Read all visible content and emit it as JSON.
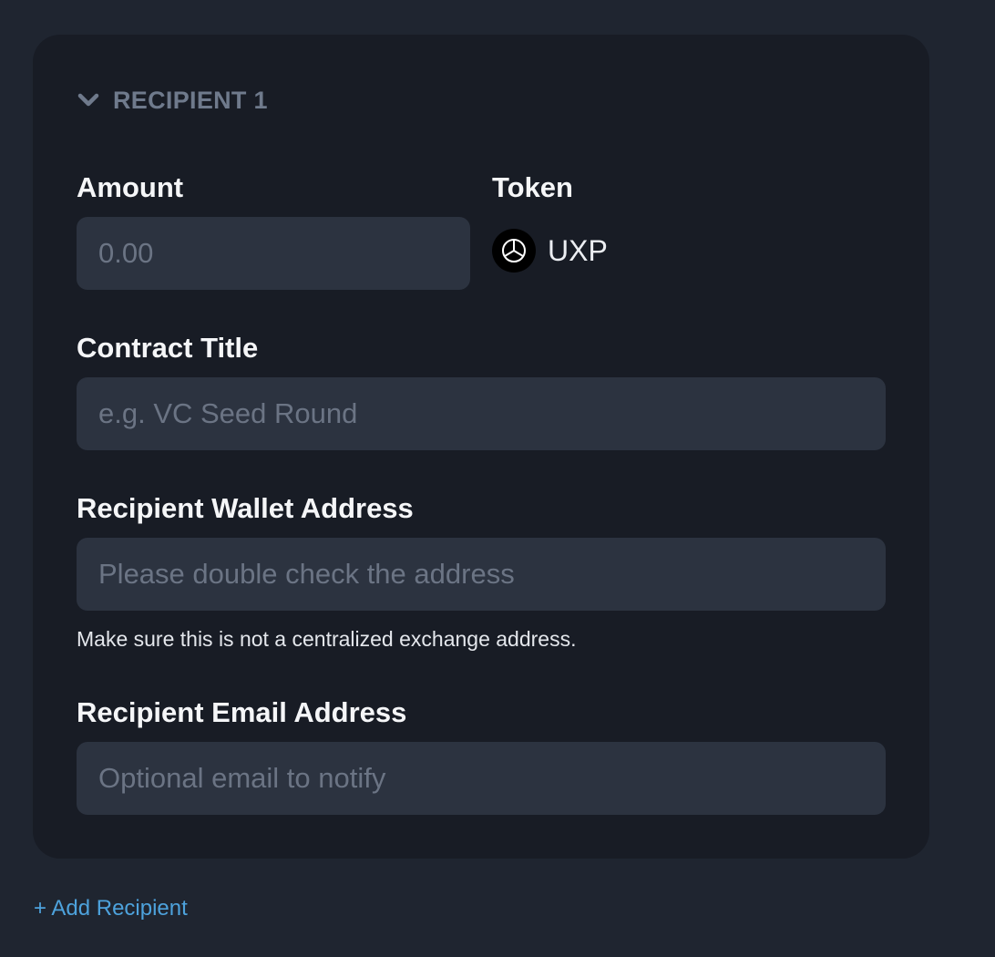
{
  "recipient_section": {
    "title": "RECIPIENT 1",
    "collapse_icon": "chevron-down-icon"
  },
  "amount": {
    "label": "Amount",
    "placeholder": "0.00",
    "value": ""
  },
  "token": {
    "label": "Token",
    "name": "UXP",
    "icon": "uxp-token-icon"
  },
  "contract_title": {
    "label": "Contract Title",
    "placeholder": "e.g. VC Seed Round",
    "value": ""
  },
  "wallet_address": {
    "label": "Recipient Wallet Address",
    "placeholder": "Please double check the address",
    "value": "",
    "helper": "Make sure this is not a centralized exchange address."
  },
  "email_address": {
    "label": "Recipient Email Address",
    "placeholder": "Optional email to notify",
    "value": ""
  },
  "add_recipient": {
    "label": "+ Add Recipient"
  },
  "colors": {
    "background": "#1f2530",
    "card": "#181c25",
    "input": "#2c3340",
    "link": "#4da2dc",
    "muted": "#6f7a8c"
  }
}
